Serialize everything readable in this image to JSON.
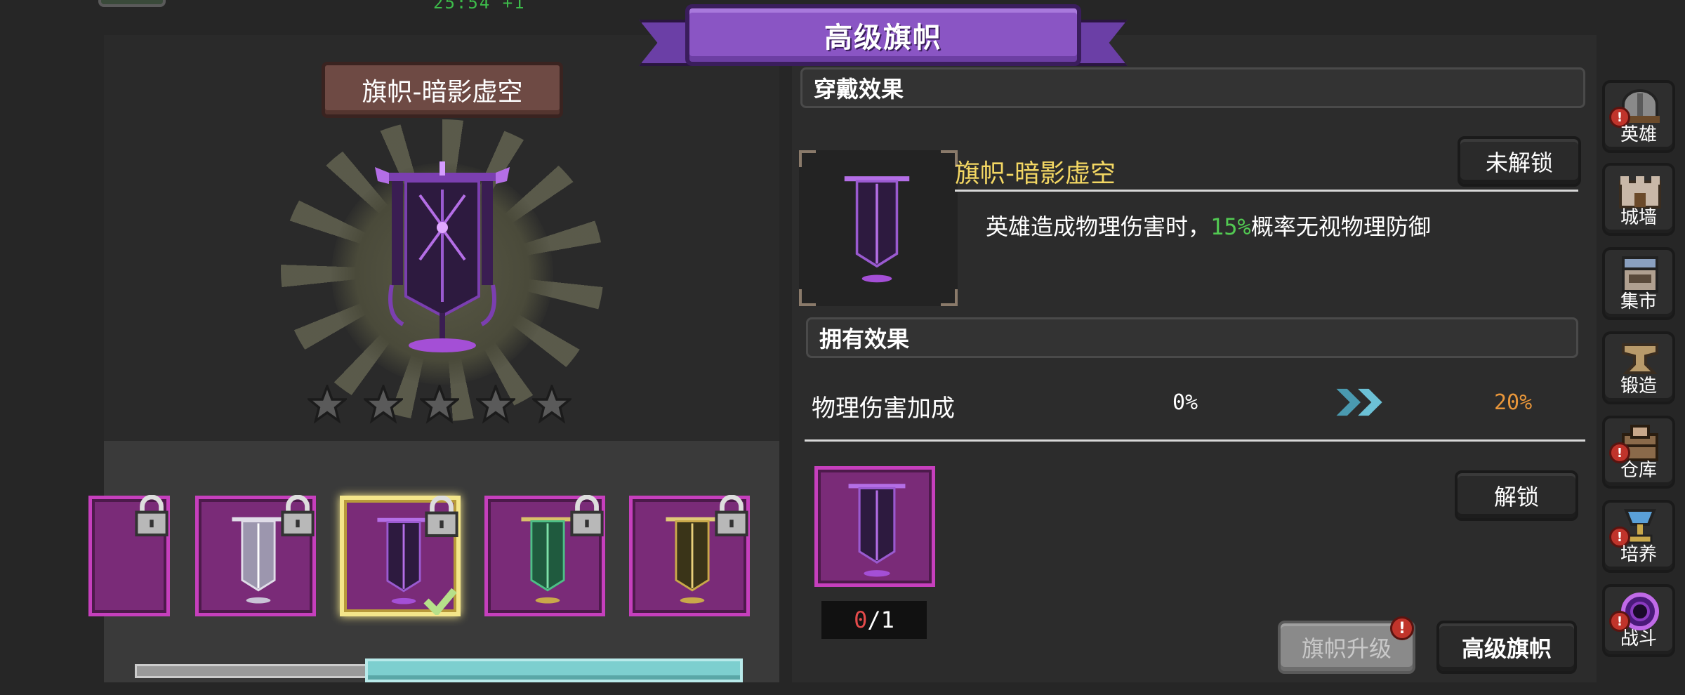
{
  "status": {
    "clock": "25:54 +1"
  },
  "header": {
    "title": "高级旗帜"
  },
  "banner": {
    "name": "旗帜-暗影虚空",
    "stars_filled": 0,
    "stars_total": 5
  },
  "slots": {
    "progress": 0.55
  },
  "wear": {
    "title": "穿戴效果",
    "name": "旗帜-暗影虚空",
    "state_button": "未解锁",
    "desc_pre": "英雄造成物理伤害时，",
    "desc_pct": "15%",
    "desc_post": "概率无视物理防御"
  },
  "own": {
    "title": "拥有效果",
    "stat_label": "物理伤害加成",
    "from": "0%",
    "to": "20%",
    "unlock_button": "解锁",
    "have": "0",
    "sep": "/",
    "need": "1"
  },
  "actions": {
    "upgrade": "旗帜升级",
    "advanced": "高级旗帜"
  },
  "nav": [
    {
      "label": "英雄",
      "icon": "helmet-icon",
      "alert": true
    },
    {
      "label": "城墙",
      "icon": "wall-icon",
      "alert": false
    },
    {
      "label": "集市",
      "icon": "market-icon",
      "alert": false
    },
    {
      "label": "锻造",
      "icon": "anvil-icon",
      "alert": false
    },
    {
      "label": "仓库",
      "icon": "warehouse-icon",
      "alert": true
    },
    {
      "label": "培养",
      "icon": "chalice-icon",
      "alert": true
    },
    {
      "label": "战斗",
      "icon": "portal-icon",
      "alert": true
    }
  ],
  "colors": {
    "accent": "#8a55c4",
    "slot": "#7a2b78",
    "slot_border": "#c63fbd",
    "gold": "#f3d763",
    "green": "#52c952",
    "orange": "#e8963a",
    "teal": "#7dcfcf"
  }
}
